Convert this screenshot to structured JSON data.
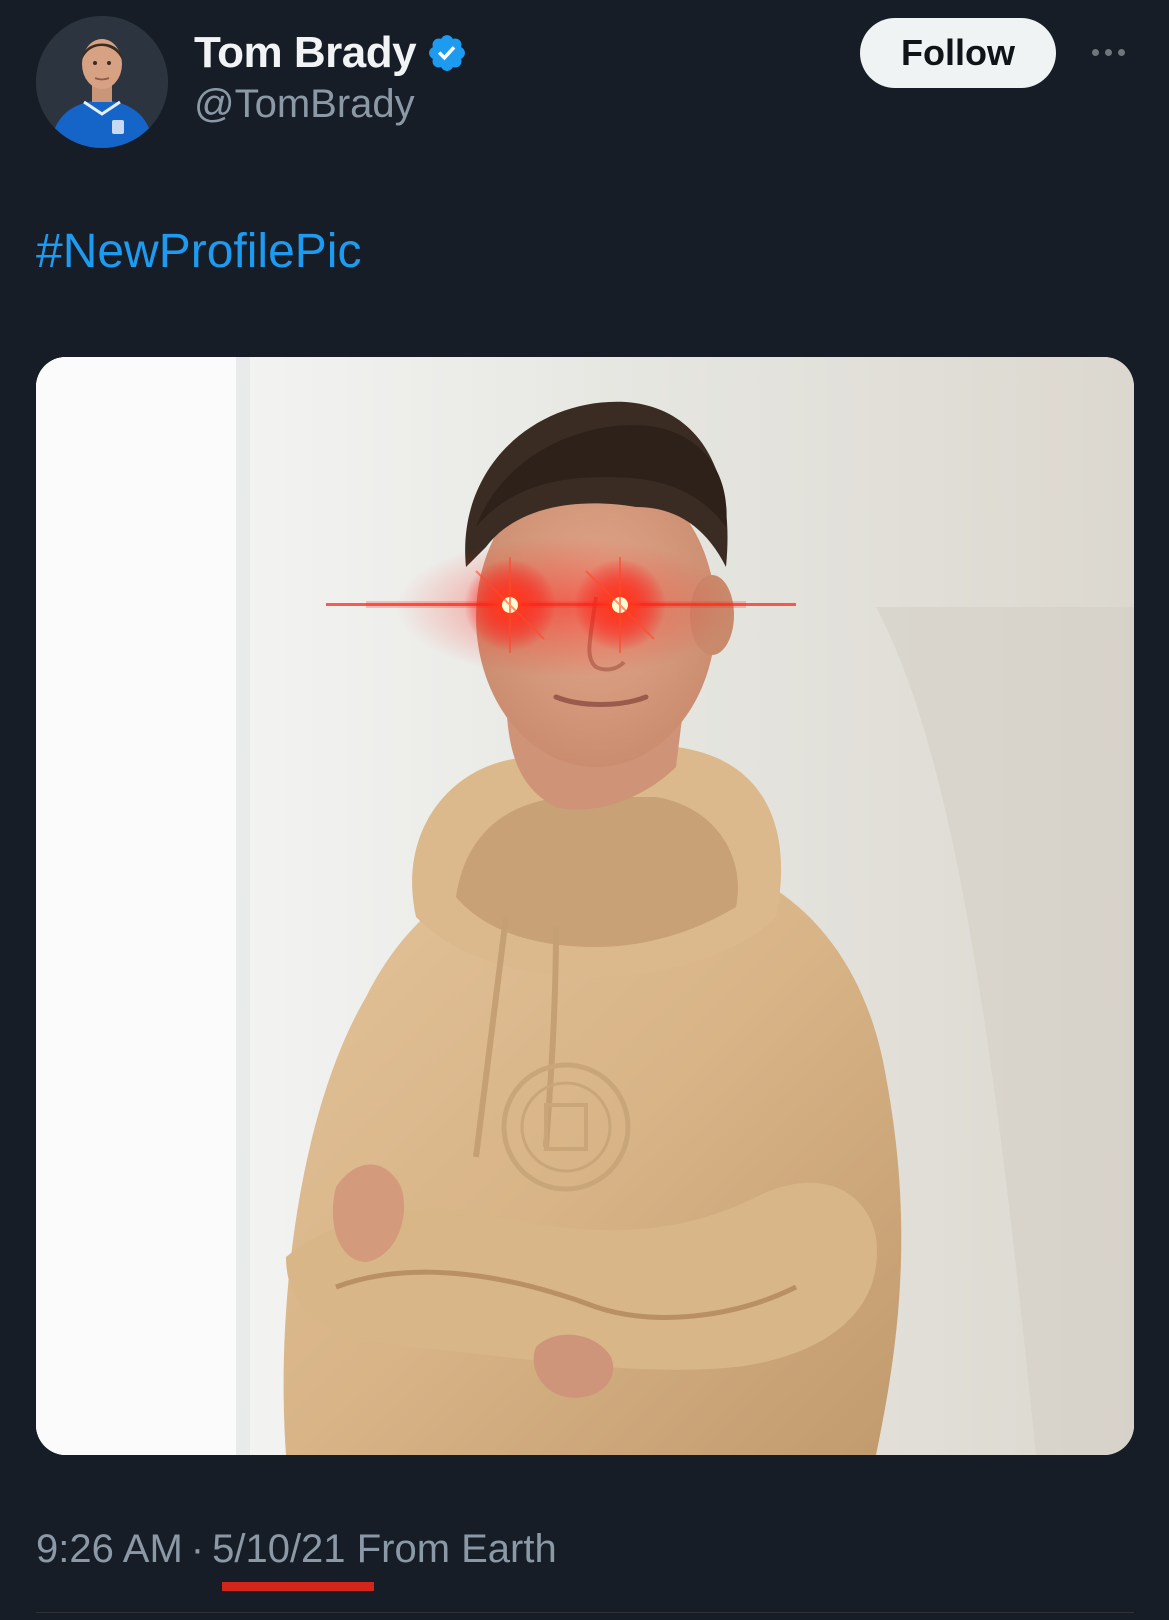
{
  "tweet": {
    "author": {
      "display_name": "Tom Brady",
      "handle": "@TomBrady",
      "verified": true,
      "verified_icon": "verified-badge-icon",
      "avatar_icon": "avatar-photo"
    },
    "follow_label": "Follow",
    "more_icon": "more-options-icon",
    "text": "#NewProfilePic",
    "media_alt": "Photo with laser eyes effect",
    "time": "9:26 AM",
    "separator": "·",
    "date": "5/10/21",
    "source": "From Earth"
  },
  "colors": {
    "background": "#161d27",
    "link": "#1d9bf0",
    "verified": "#1d9bf0",
    "secondary_text": "#8b98a5",
    "follow_button_bg": "#eff3f4",
    "highlight_underline": "#d4251b"
  }
}
